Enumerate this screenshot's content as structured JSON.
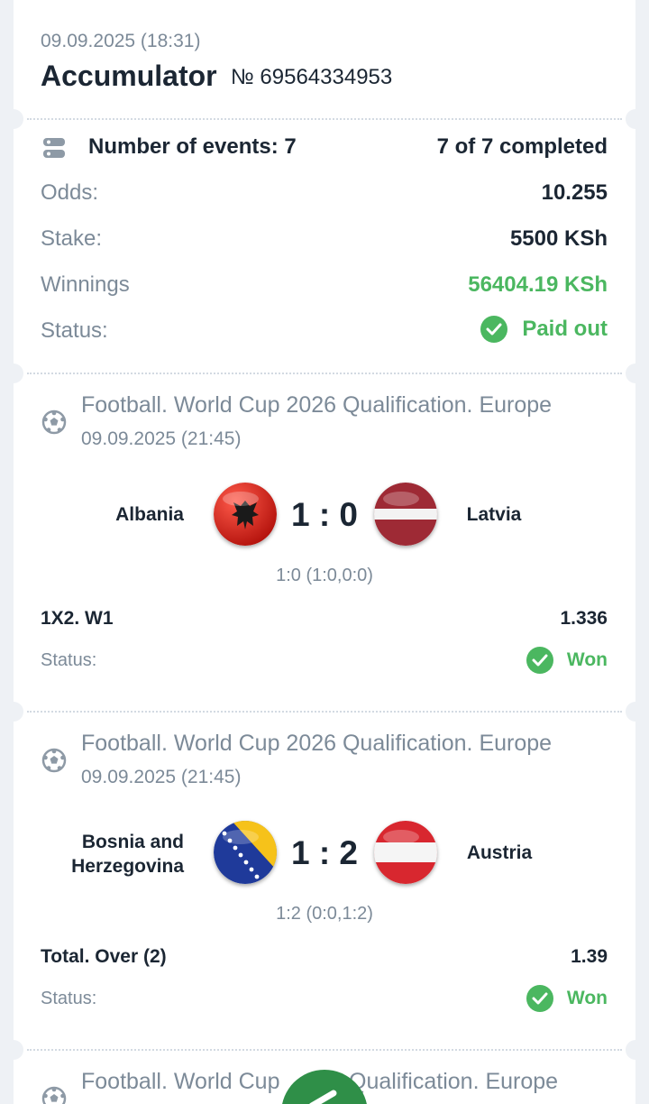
{
  "header": {
    "date": "09.09.2025 (18:31)",
    "title": "Accumulator",
    "number": "№ 69564334953"
  },
  "summary": {
    "events_label": "Number of events: 7",
    "completed": "7 of 7 completed",
    "odds_label": "Odds:",
    "odds_value": "10.255",
    "stake_label": "Stake:",
    "stake_value": "5500 KSh",
    "winnings_label": "Winnings",
    "winnings_value": "56404.19 KSh",
    "status_label": "Status:",
    "status_value": "Paid out"
  },
  "events": [
    {
      "league": "Football. World Cup 2026 Qualification. Europe",
      "date": "09.09.2025 (21:45)",
      "home": "Albania",
      "away": "Latvia",
      "score": "1 : 0",
      "detail": "1:0 (1:0,0:0)",
      "market": "1X2. W1",
      "odd": "1.336",
      "status_label": "Status:",
      "status_value": "Won"
    },
    {
      "league": "Football. World Cup 2026 Qualification. Europe",
      "date": "09.09.2025 (21:45)",
      "home_line1": "Bosnia and",
      "home_line2": "Herzegovina",
      "away": "Austria",
      "score": "1 : 2",
      "detail": "1:2 (0:0,1:2)",
      "market": "Total. Over (2)",
      "odd": "1.39",
      "status_label": "Status:",
      "status_value": "Won"
    },
    {
      "league_visible": "Football. World Cup",
      "league_visible_tail": "Qualification. Europe"
    }
  ],
  "colors": {
    "accent_green": "#4bb760",
    "text_dark": "#1b2633",
    "text_muted": "#7c8a98",
    "background": "#eef1f5"
  }
}
